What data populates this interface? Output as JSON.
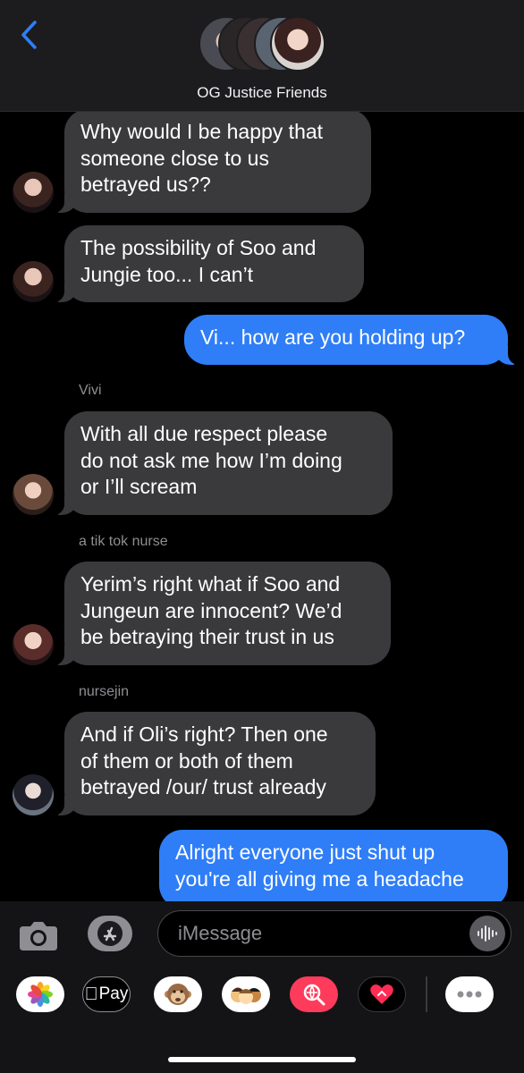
{
  "header": {
    "group_name": "OG Justice Friends",
    "back_icon": "chevron-left-icon",
    "accent_color": "#2f7ef8"
  },
  "messages": [
    {
      "direction": "incoming",
      "lines": [
        "Why would I be happy that",
        "someone close to us",
        "betrayed us??"
      ]
    },
    {
      "direction": "incoming",
      "lines": [
        "The possibility of Soo and",
        "Jungie too... I can’t"
      ]
    },
    {
      "direction": "outgoing",
      "lines": [
        "Vi... how are you holding up?"
      ]
    },
    {
      "direction": "incoming",
      "sender": "Vivi",
      "lines": [
        "With all due respect please",
        "do not ask me how I’m doing",
        "or I’ll scream"
      ]
    },
    {
      "direction": "incoming",
      "sender": "a tik tok nurse",
      "lines": [
        "Yerim’s right what if Soo and",
        "Jungeun are innocent? We’d",
        "be betraying their trust in us"
      ]
    },
    {
      "direction": "incoming",
      "sender": "nursejin",
      "lines": [
        "And if Oli’s right? Then one",
        "of them or both of them",
        "betrayed /our/ trust already"
      ]
    },
    {
      "direction": "outgoing",
      "lines": [
        "Alright everyone just shut up",
        "you're all giving me a headache"
      ]
    }
  ],
  "input": {
    "placeholder": "iMessage",
    "camera_icon": "camera-icon",
    "app_store_icon": "app-store-icon",
    "audio_icon": "audio-waveform-icon"
  },
  "app_drawer": {
    "apple_pay_label": "Pay",
    "items": [
      "photos-icon",
      "apple-pay-icon",
      "animoji-icon",
      "memoji-icon",
      "image-search-icon",
      "digital-touch-icon",
      "more-icon"
    ]
  }
}
